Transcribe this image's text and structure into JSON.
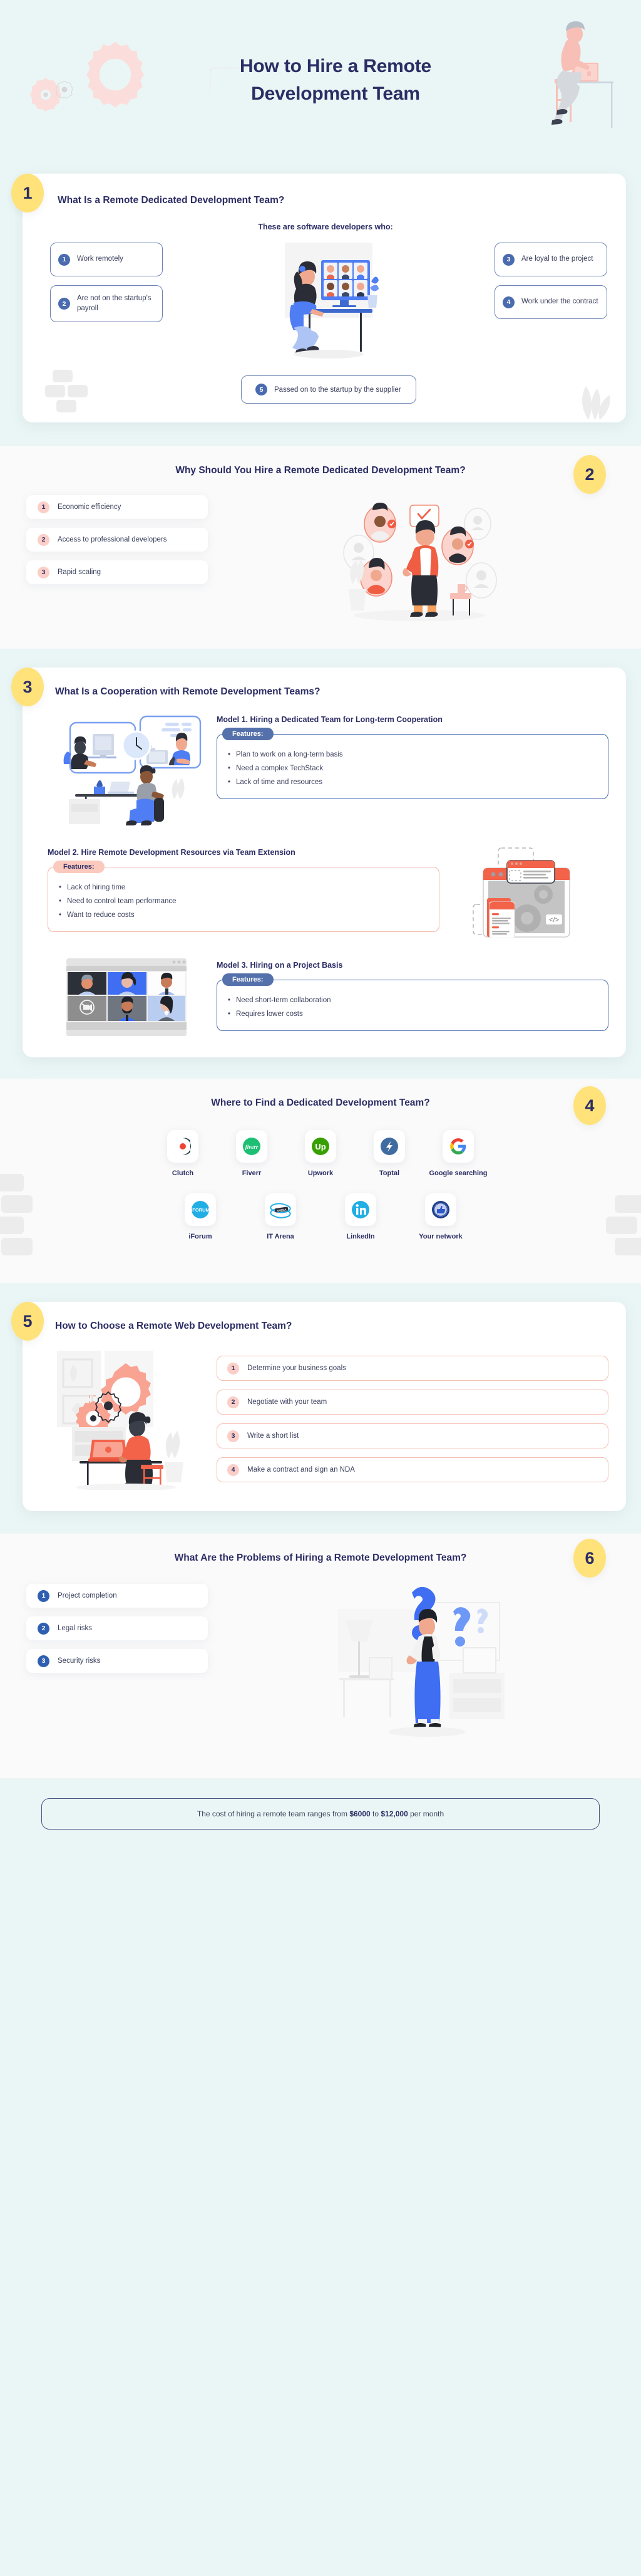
{
  "header": {
    "title_line1": "How to Hire a Remote",
    "title_line2": "Development Team"
  },
  "sections": [
    {
      "number": "1",
      "title": "What Is a Remote Dedicated Development Team?",
      "subtitle": "These are software developers who:",
      "left_items": [
        {
          "num": "1",
          "label": "Work remotely"
        },
        {
          "num": "2",
          "label": "Are not on the startup's payroll"
        }
      ],
      "right_items": [
        {
          "num": "3",
          "label": "Are loyal to the project"
        },
        {
          "num": "4",
          "label": "Work under the contract"
        }
      ],
      "bottom_item": {
        "num": "5",
        "label": "Passed on to the startup by the supplier"
      }
    },
    {
      "number": "2",
      "title": "Why Should You Hire a Remote Dedicated Development Team?",
      "items": [
        {
          "num": "1",
          "label": "Economic efficiency"
        },
        {
          "num": "2",
          "label": "Access to professional developers"
        },
        {
          "num": "3",
          "label": "Rapid scaling"
        }
      ]
    },
    {
      "number": "3",
      "title": "What Is a Cooperation with Remote Development Teams?",
      "features_label": "Features:",
      "models": [
        {
          "title": "Model 1. Hiring a Dedicated Team for Long-term Cooperation",
          "features": [
            "Plan to work on a long-term basis",
            "Need a complex TechStack",
            "Lack of time and resources"
          ]
        },
        {
          "title": "Model 2. Hire Remote Development Resources via Team Extension",
          "features": [
            "Lack of hiring time",
            "Need to control team performance",
            "Want to reduce costs"
          ]
        },
        {
          "title": "Model 3. Hiring on a Project Basis",
          "features": [
            "Need short-term collaboration",
            "Requires lower costs"
          ]
        }
      ]
    },
    {
      "number": "4",
      "title": "Where to Find a Dedicated Development Team?",
      "row1": [
        {
          "label": "Clutch",
          "icon": "clutch-logo"
        },
        {
          "label": "Fiverr",
          "icon": "fiverr-logo"
        },
        {
          "label": "Upwork",
          "icon": "upwork-logo"
        },
        {
          "label": "Toptal",
          "icon": "toptal-logo"
        },
        {
          "label": "Google searching",
          "icon": "google-logo"
        }
      ],
      "row2": [
        {
          "label": "iForum",
          "icon": "iforum-logo"
        },
        {
          "label": "IT Arena",
          "icon": "it-arena-logo"
        },
        {
          "label": "LinkedIn",
          "icon": "linkedin-logo"
        },
        {
          "label": "Your network",
          "icon": "your-network-logo"
        }
      ]
    },
    {
      "number": "5",
      "title": "How to Choose a Remote Web Development Team?",
      "items": [
        {
          "num": "1",
          "label": "Determine your business goals"
        },
        {
          "num": "2",
          "label": "Negotiate with your team"
        },
        {
          "num": "3",
          "label": "Write a short list"
        },
        {
          "num": "4",
          "label": "Make a contract and sign an NDA"
        }
      ]
    },
    {
      "number": "6",
      "title": "What Are the Problems of Hiring a Remote Development Team?",
      "items": [
        {
          "num": "1",
          "label": "Project completion"
        },
        {
          "num": "2",
          "label": "Legal risks"
        },
        {
          "num": "3",
          "label": "Security risks"
        }
      ]
    }
  ],
  "footer": {
    "text_before": "The cost of hiring a remote team ranges from ",
    "amount_low": "$6000",
    "text_mid": " to ",
    "amount_high": "$12,000",
    "text_after": " per month"
  },
  "colors": {
    "mint_bg": "#eaf6f5",
    "white_bg": "#fafafa",
    "navy": "#2b2d64",
    "yellow": "#ffe27a",
    "blue": "#4a6baf",
    "pink": "#fbcfc8",
    "coral": "#f2634a"
  }
}
